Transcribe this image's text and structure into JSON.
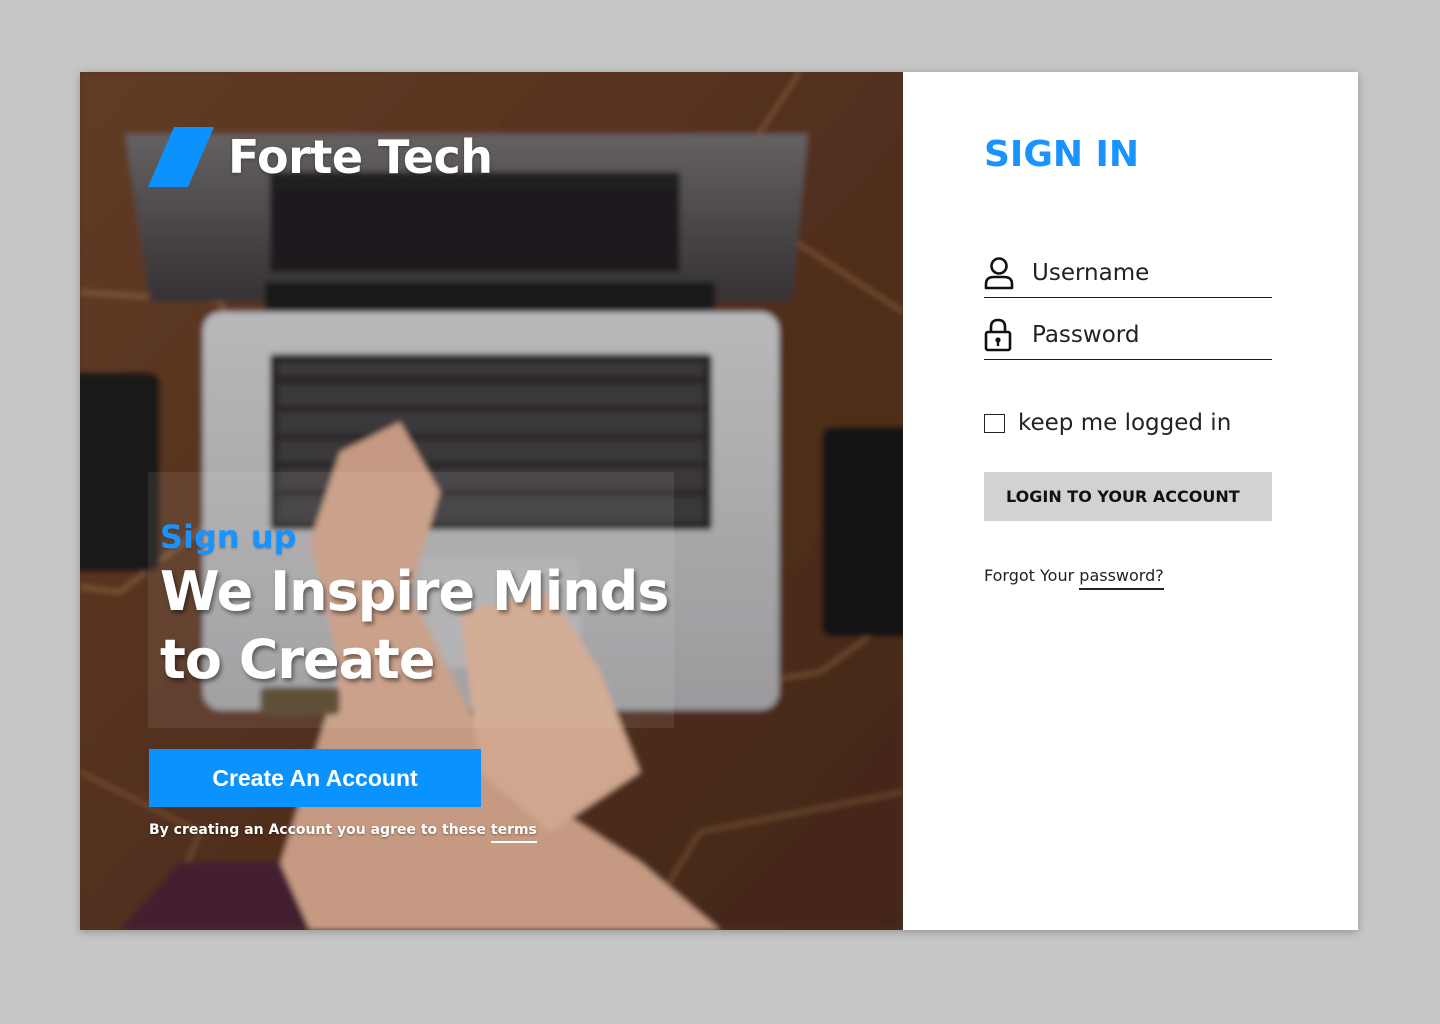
{
  "brand": {
    "name": "Forte Tech",
    "mark_color": "#0a93ff"
  },
  "hero": {
    "signup_label": "Sign up",
    "headline": "We Inspire Minds to Create",
    "create_button": "Create An Account",
    "terms_text": "By creating an Account you agree to these",
    "terms_link": "terms",
    "background_description_icon": "laptop-desk-photo"
  },
  "signin": {
    "title": "SIGN IN",
    "username_placeholder": "Username",
    "password_placeholder": "Password",
    "remember_label": "keep me logged in",
    "remember_checked": false,
    "login_button": "LOGIN TO YOUR ACCOUNT",
    "forgot_prefix": "Forgot Your",
    "forgot_link": "password?"
  },
  "colors": {
    "accent": "#1a93ff",
    "button_blue": "#0a93ff",
    "login_button_bg": "#d2d2d2",
    "page_bg": "#c6c6c6"
  },
  "icons": {
    "username": "user-icon",
    "password": "lock-icon"
  }
}
